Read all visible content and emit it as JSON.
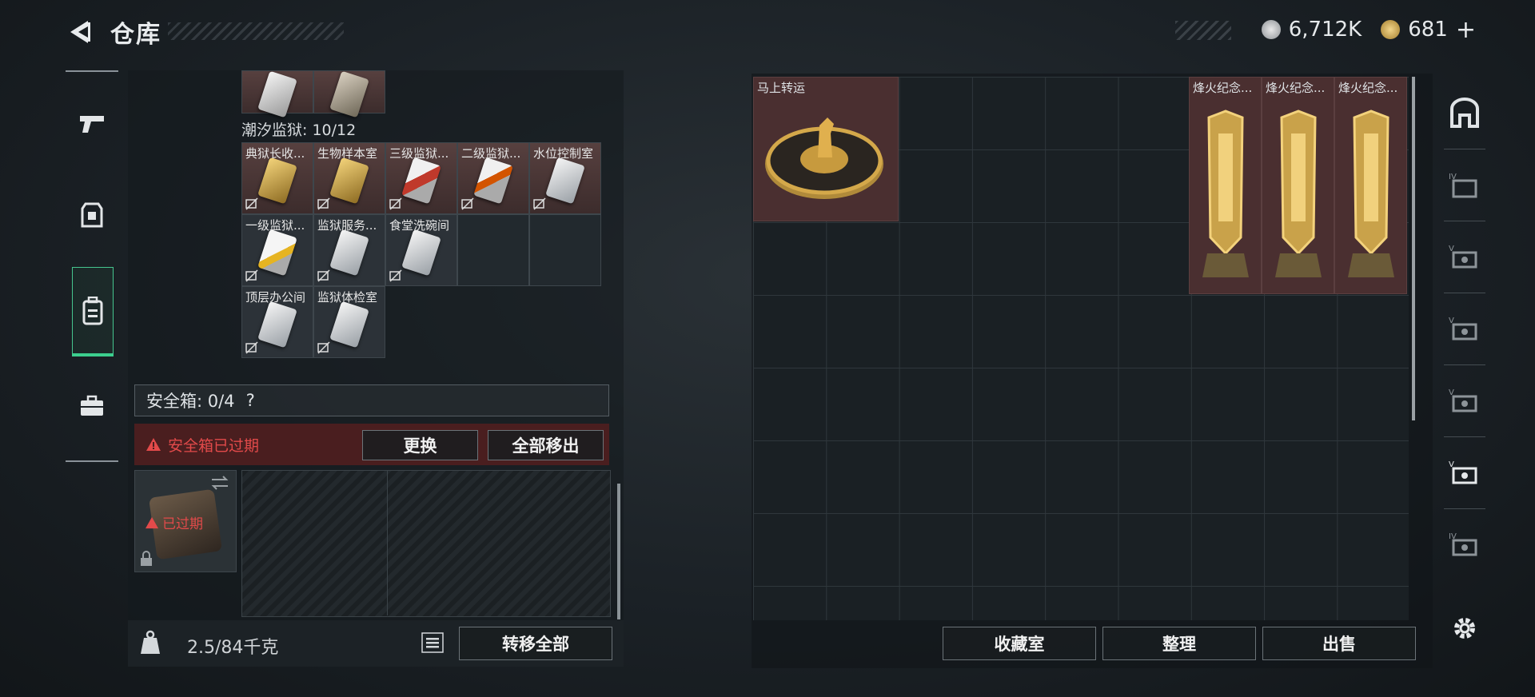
{
  "header": {
    "title": "仓库"
  },
  "currency": {
    "silver": "6,712K",
    "gold": "681"
  },
  "prison": {
    "label": "潮汐监狱: 10/12",
    "items": [
      "典狱长收...",
      "生物样本室",
      "三级监狱...",
      "二级监狱...",
      "水位控制室",
      "一级监狱...",
      "监狱服务...",
      "食堂洗碗间",
      "顶层办公间",
      "监狱体检室"
    ]
  },
  "safe": {
    "label": "安全箱: 0/4",
    "help": "?",
    "expired_msg": "安全箱已过期",
    "replace_btn": "更换",
    "remove_all_btn": "全部移出",
    "box_badge": "已过期"
  },
  "bottom": {
    "weight": "2.5/84千克",
    "transfer_all_btn": "转移全部"
  },
  "stash": {
    "items": [
      {
        "name": "马上转运"
      },
      {
        "name": "烽火纪念..."
      },
      {
        "name": "烽火纪念..."
      },
      {
        "name": "烽火纪念..."
      }
    ]
  },
  "actions": {
    "collection": "收藏室",
    "sort": "整理",
    "sell": "出售"
  },
  "colors": {
    "accent": "#3ccf8e",
    "alert": "#e24a4a",
    "item_bg": "#4a2f30"
  },
  "icons": {
    "left": [
      "pistol-icon",
      "armor-icon",
      "backpack-icon",
      "briefcase-icon"
    ],
    "right": [
      "safehouse-icon",
      "case-icon",
      "ticket-icon",
      "ticket-icon",
      "ticket-icon",
      "ticket-icon",
      "ticket-icon",
      "settings-icon"
    ]
  }
}
